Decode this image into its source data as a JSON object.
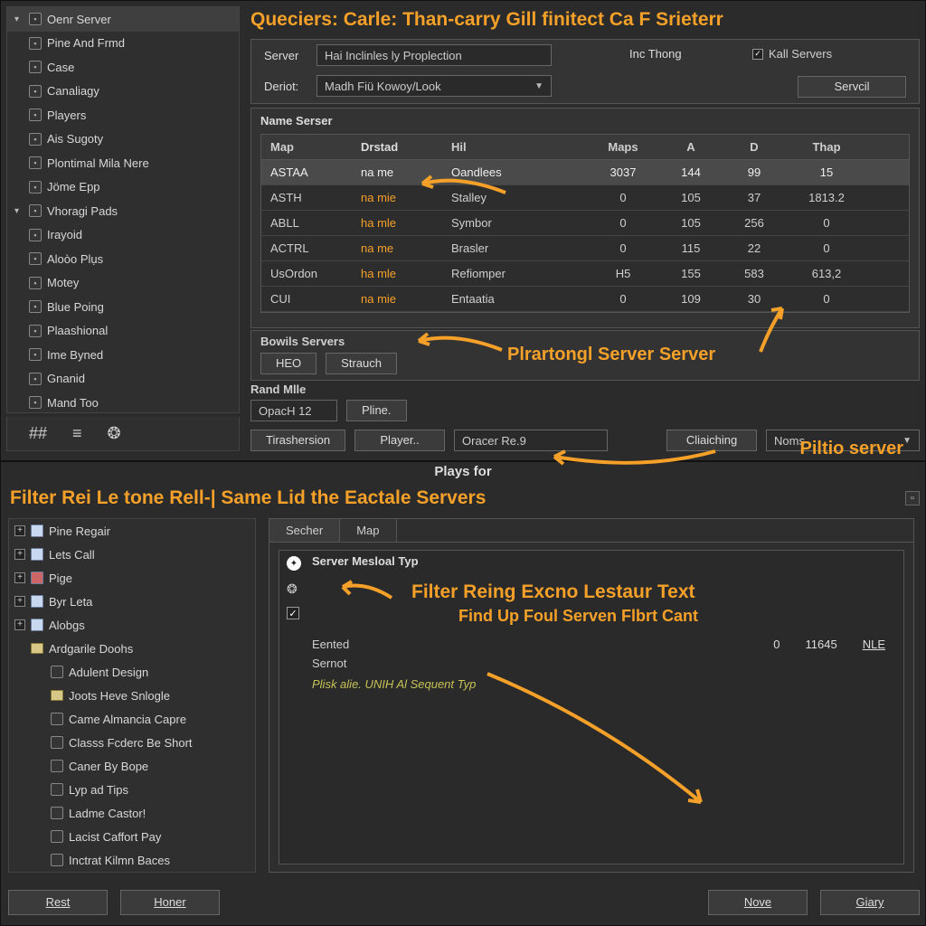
{
  "top": {
    "heading": "Queciers: Carle: Than-carry Gill finitect Ca F Srieterr",
    "sidebar": [
      {
        "label": "Oenr Server",
        "exp": "▾",
        "sel": true
      },
      {
        "label": "Pine And Frmd"
      },
      {
        "label": "Case"
      },
      {
        "label": "Canaliagy"
      },
      {
        "label": "Players"
      },
      {
        "label": "Ais Sugoty"
      },
      {
        "label": "Plontimal Mila Nere"
      },
      {
        "label": "Jöme Epp"
      },
      {
        "label": "Vhoragi Pads",
        "exp": "▾"
      },
      {
        "label": "Irayoid"
      },
      {
        "label": "Aloòo Plụs"
      },
      {
        "label": "Motey"
      },
      {
        "label": "Blue Poing"
      },
      {
        "label": "Plaashional"
      },
      {
        "label": "Ime Byned"
      },
      {
        "label": "Gnanid"
      },
      {
        "label": "Mand Too"
      }
    ],
    "filter": {
      "server_label": "Server",
      "server_value": "Hai Inclinles ly Proplection",
      "deriot_label": "Deriot:",
      "deriot_value": "Madh Fiü Kowoy/Look",
      "inc_thong": "Inc Thong",
      "kall_label": "Kall Servers",
      "servcil_btn": "Servcil"
    },
    "table": {
      "title": "Name Serser",
      "cols": {
        "map": "Map",
        "dr": "Drstad",
        "hi": "Hil",
        "maps": "Maps",
        "a": "A",
        "d": "D",
        "th": "Thap"
      },
      "rows": [
        {
          "map": "ASTAA",
          "dr": "na me",
          "hi": "Oandlees",
          "maps": "3037",
          "a": "144",
          "d": "99",
          "th": "15",
          "sel": true
        },
        {
          "map": "ASTH",
          "dr": "na mie",
          "hi": "Stalley",
          "maps": "0",
          "a": "105",
          "d": "37",
          "th": "1813.2"
        },
        {
          "map": "ABLL",
          "dr": "ha mle",
          "hi": "Symbor",
          "maps": "0",
          "a": "105",
          "d": "256",
          "th": "0"
        },
        {
          "map": "ACTRL",
          "dr": "na me",
          "hi": "Brasler",
          "maps": "0",
          "a": "115",
          "d": "22",
          "th": "0"
        },
        {
          "map": "UsOrdon",
          "dr": "ha mle",
          "hi": "Refiomper",
          "maps": "H5",
          "a": "155",
          "d": "583",
          "th": "613,2"
        },
        {
          "map": "CUI",
          "dr": "na mie",
          "hi": "Entaatia",
          "maps": "0",
          "a": "109",
          "d": "30",
          "th": "0"
        }
      ]
    },
    "bowls": {
      "title": "Bowils Servers",
      "b1": "HEO",
      "b2": "Strauch"
    },
    "rand": {
      "title": "Rand Mlle",
      "val": "OpacH 12",
      "btn": "Pline."
    },
    "toolbar": {
      "hash": "##"
    },
    "actionbar": {
      "b1": "Tirashersion",
      "b2": "Player..",
      "search": "Oracer Re.9",
      "b3": "Cliaiching",
      "dd": "Noms"
    },
    "anno1": "Plrartongl Server Server",
    "anno2": "Piltio server"
  },
  "plays_for": "Plays for",
  "bottom": {
    "heading": "Filter Rei Le tone Rell-| Same Lid the Eactale Servers",
    "sidebar": [
      {
        "label": "Pine Regair",
        "ic": "doc",
        "plus": true
      },
      {
        "label": "Lets Call",
        "ic": "doc",
        "plus": true
      },
      {
        "label": "Pige",
        "ic": "red",
        "plus": true
      },
      {
        "label": "Byr Leta",
        "ic": "doc",
        "plus": true
      },
      {
        "label": "Alobgs",
        "ic": "doc",
        "plus": true
      },
      {
        "label": "Ardgarile Doohs",
        "ic": "folder"
      },
      {
        "label": "Adulent Design",
        "ic": "box",
        "indent": true
      },
      {
        "label": "Joots Heve Snlogle",
        "ic": "folder",
        "indent": true
      },
      {
        "label": "Came Almancia Capre",
        "ic": "box",
        "indent": true
      },
      {
        "label": "Classs Fcderc Be Short",
        "ic": "box",
        "indent": true
      },
      {
        "label": "Caner By Bope",
        "ic": "box",
        "indent": true
      },
      {
        "label": "Lyp ad Tips",
        "ic": "box",
        "indent": true
      },
      {
        "label": "Ladme Castor!",
        "ic": "box",
        "indent": true
      },
      {
        "label": "Lacist Caffort Pay",
        "ic": "box",
        "indent": true
      },
      {
        "label": "Inctrat Kilmn Baces",
        "ic": "box",
        "indent": true
      }
    ],
    "tabs": {
      "t1": "Secher",
      "t2": "Map"
    },
    "inner": {
      "title": "Server Mesloal Typ",
      "mid1": "Filter Reing Excno Lestaur Text",
      "mid2": "Find Up Foul Serven Flbrt Cant",
      "f1": "Eented",
      "f2": "Sernot",
      "n1": "0",
      "n2": "11645",
      "n3": "NLE",
      "hint": "Plisk alie. UNIH Al Sequent Typ"
    },
    "buttons": {
      "b1": "Rest",
      "b2": "Honer",
      "b3": "Nove",
      "b4": "Giary"
    }
  }
}
